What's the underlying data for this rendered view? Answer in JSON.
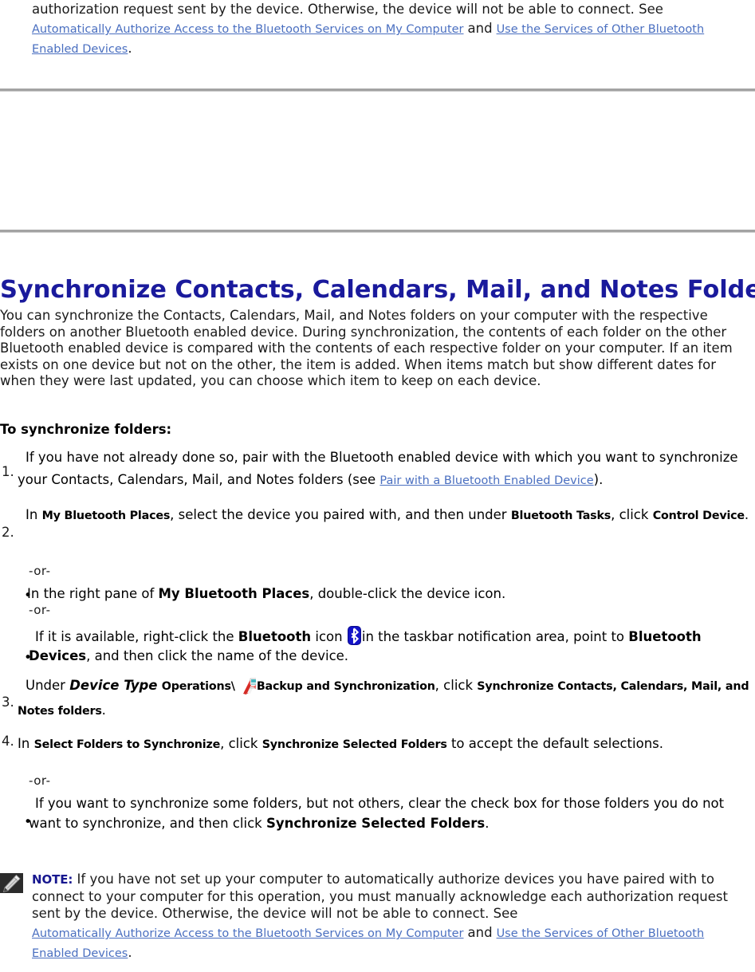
{
  "document": {
    "title": "Synchronize Contacts, Calendars, Mail, and Notes Folders",
    "intro": "You can synchronize the Contacts, Calendars, Mail, and Notes folders on your computer with the respective folders on another Bluetooth enabled device. During synchronization, the contents of each folder on the other Bluetooth enabled device is compared with the contents of each respective folder on your computer. If an item exists on one device but not on the other, the item is added. When items match but show different dates for when they were last updated, you can choose which item to keep on each device.",
    "howto_label": "To synchronize folders:"
  },
  "colors": {
    "heading": "#1a1a9c",
    "link": "#4a6fc0",
    "note_keyword": "#17178f",
    "rule": "#a3a3a3",
    "bluetooth_icon": "#1414c8"
  },
  "top_note": {
    "text_1": "authorization request sent by the device. Otherwise, the device will not be able to connect. See",
    "link_1": "Automatically Authorize Access to the Bluetooth Services on My Computer",
    "conjunction": "and",
    "link_2": "Use the Services of Other Bluetooth Enabled Devices",
    "period": "."
  },
  "steps": [
    {
      "marker": "1.",
      "t1": "If you have not already done so, pair with the Bluetooth enabled device with which you want to synchronize your Contacts, Calendars, Mail, and Notes folders (see ",
      "link": "Pair with a Bluetooth Enabled Device",
      "t2": ")."
    },
    {
      "marker": "2.",
      "t1": "In ",
      "ui1": "My Bluetooth Places",
      "t2": ", select the device you paired with, and then under ",
      "ui2": "Bluetooth Tasks",
      "t3": ", click ",
      "ui3": "Control Device",
      "t4": "."
    },
    {
      "marker": "3.",
      "t1": "Under ",
      "bi1": "Device Type",
      "ui1": "Operations\\",
      "icon": "operations-backup-sync-icon",
      "ui2": "Backup and Synchronization",
      "t2": ", click ",
      "ui3": "Synchronize Contacts, Calendars, Mail, and Notes folders",
      "t3": "."
    },
    {
      "marker": "4.",
      "t1": "In ",
      "ui1": "Select Folders to Synchronize",
      "t2": ", click ",
      "ui2": "Synchronize Selected Folders",
      "t3": " to accept the default selections."
    }
  ],
  "or_separator": "-or-",
  "bullets": {
    "b1": {
      "t1": "In the right pane of ",
      "b1": "My Bluetooth Places",
      "t2": ", double-click the device icon."
    },
    "b2": {
      "t1": "If it is available, right-click the ",
      "b1": "Bluetooth",
      "t2": " icon ",
      "icon": "bluetooth-icon",
      "t3": "in the taskbar notification area, point to ",
      "b2": "Bluetooth Devices",
      "t4": ", and then click the name of the device."
    },
    "b3": {
      "t1": "If you want to synchronize some folders, but not others, clear the check box for those folders you do not want to synchronize, and then click ",
      "b1": "Synchronize Selected Folders",
      "t2": "."
    }
  },
  "bottom_note": {
    "icon": "pencil-note-icon",
    "keyword": "NOTE:",
    "text_1": " If you have not set up your computer to automatically authorize devices you have paired with to connect to your computer for this operation, you must manually acknowledge each authorization request sent by the device. Otherwise, the device will not be able to connect. See",
    "link_1": "Automatically Authorize Access to the Bluetooth Services on My Computer",
    "conjunction": "and",
    "link_2": "Use the Services of Other Bluetooth Enabled Devices",
    "period": "."
  }
}
